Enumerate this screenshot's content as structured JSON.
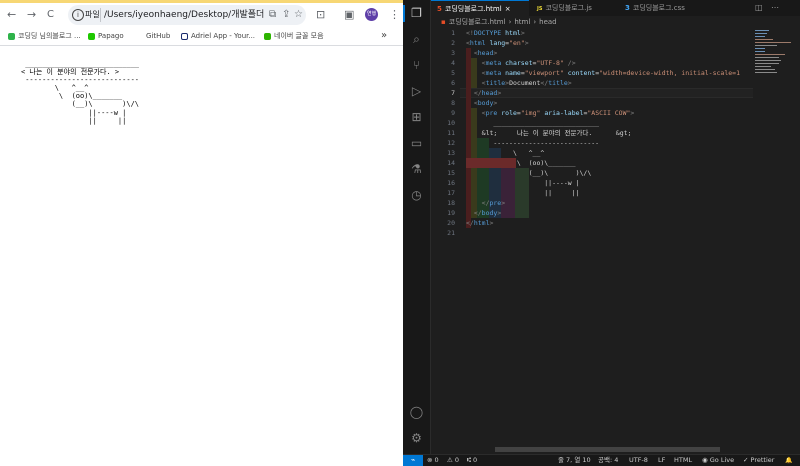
{
  "browser": {
    "nav": {
      "back": "←",
      "forward": "→",
      "reload": "C"
    },
    "omnibox": {
      "info_icon": "i",
      "chip": "파일",
      "url": "/Users/iyeonhaeng/Desktop/개발폴더/html테...",
      "translate_icon": "⧉",
      "share_icon": "⇪",
      "star_icon": "☆"
    },
    "toolbar": {
      "extensions_icon": "⊡",
      "sidepanel_icon": "▣",
      "avatar": "연행",
      "menu_icon": "⋮"
    },
    "bookmarks": [
      {
        "label": "코딩딩 님의블로그 ...",
        "color": "#2eb34a"
      },
      {
        "label": "Papago",
        "color": "#1ec800"
      },
      {
        "label": "GitHub",
        "color": "#ffffff"
      },
      {
        "label": "Adriel App - Your...",
        "color": "#ffffff"
      },
      {
        "label": "네이버 글꼴 모음",
        "color": "#2db400"
      }
    ],
    "bookmarks_more": "»",
    "ascii_art": " ___________________________\n< 나는 이 분야의 전문가다. >\n ---------------------------\n        \\   ^__^\n         \\  (oo)\\_______\n            (__)\\       )\\/\\\n                ||----w |\n                ||     ||"
  },
  "vscode": {
    "tabs": [
      {
        "label": "코딩딩블로그.html",
        "icon": "5",
        "icon_color": "#e44d26",
        "active": true,
        "close": "×"
      },
      {
        "label": "코딩딩블로그.js",
        "icon": "JS",
        "icon_color": "#f1dd35",
        "active": false
      },
      {
        "label": "코딩딩블로그.css",
        "icon": "3",
        "icon_color": "#42a5f5",
        "active": false
      }
    ],
    "editor_actions": {
      "split": "◫",
      "more": "⋯"
    },
    "breadcrumb": {
      "file": "코딩딩블로그.html",
      "sep1": "›",
      "el1": "html",
      "sep2": "›",
      "el2": "head"
    },
    "activity_icons": [
      {
        "name": "explorer-icon",
        "glyph": "❐"
      },
      {
        "name": "search-icon",
        "glyph": "⌕"
      },
      {
        "name": "source-control-icon",
        "glyph": "⑂"
      },
      {
        "name": "run-debug-icon",
        "glyph": "▷"
      },
      {
        "name": "extensions-icon",
        "glyph": "⊞"
      },
      {
        "name": "remote-explorer-icon",
        "glyph": "▭"
      },
      {
        "name": "testing-icon",
        "glyph": "⚗"
      },
      {
        "name": "timeline-icon",
        "glyph": "◷"
      }
    ],
    "activity_bottom": {
      "accounts": "◯",
      "manage": "⚙"
    },
    "line_numbers": [
      "1",
      "2",
      "3",
      "4",
      "5",
      "6",
      "7",
      "8",
      "9",
      "10",
      "11",
      "12",
      "13",
      "14",
      "15",
      "16",
      "17",
      "18",
      "19",
      "20",
      "21"
    ],
    "code": [
      [
        [
          "p",
          "<!"
        ],
        [
          "t",
          "DOCTYPE"
        ],
        [
          "a",
          " html"
        ],
        [
          "p",
          ">"
        ]
      ],
      [
        [
          "p",
          "<"
        ],
        [
          "t",
          "html"
        ],
        [
          "a",
          " lang"
        ],
        [
          "x",
          "="
        ],
        [
          "s",
          "\"en\""
        ],
        [
          "p",
          ">"
        ]
      ],
      [
        [
          "x",
          "  "
        ],
        [
          "p",
          "<"
        ],
        [
          "t",
          "head"
        ],
        [
          "p",
          ">"
        ]
      ],
      [
        [
          "x",
          "    "
        ],
        [
          "p",
          "<"
        ],
        [
          "t",
          "meta"
        ],
        [
          "a",
          " charset"
        ],
        [
          "x",
          "="
        ],
        [
          "s",
          "\"UTF-8\""
        ],
        [
          "p",
          " />"
        ]
      ],
      [
        [
          "x",
          "    "
        ],
        [
          "p",
          "<"
        ],
        [
          "t",
          "meta"
        ],
        [
          "a",
          " name"
        ],
        [
          "x",
          "="
        ],
        [
          "s",
          "\"viewport\""
        ],
        [
          "a",
          " content"
        ],
        [
          "x",
          "="
        ],
        [
          "s",
          "\"width=device-width, initial-scale=1"
        ]
      ],
      [
        [
          "x",
          "    "
        ],
        [
          "p",
          "<"
        ],
        [
          "t",
          "title"
        ],
        [
          "p",
          ">"
        ],
        [
          "x",
          "Document"
        ],
        [
          "p",
          "</"
        ],
        [
          "t",
          "title"
        ],
        [
          "p",
          ">"
        ]
      ],
      [
        [
          "x",
          "  "
        ],
        [
          "p",
          "</"
        ],
        [
          "t",
          "head"
        ],
        [
          "p",
          ">"
        ]
      ],
      [
        [
          "x",
          "  "
        ],
        [
          "p",
          "<"
        ],
        [
          "t",
          "body"
        ],
        [
          "p",
          ">"
        ]
      ],
      [
        [
          "x",
          "    "
        ],
        [
          "p",
          "<"
        ],
        [
          "t",
          "pre"
        ],
        [
          "a",
          " role"
        ],
        [
          "x",
          "="
        ],
        [
          "s",
          "\"img\""
        ],
        [
          "a",
          " aria-label"
        ],
        [
          "x",
          "="
        ],
        [
          "s",
          "\"ASCII COW\""
        ],
        [
          "p",
          ">"
        ]
      ],
      [
        [
          "x",
          "       ___________________________"
        ]
      ],
      [
        [
          "x",
          "    &lt;     나는 이 분야의 전문가다.      &gt;"
        ]
      ],
      [
        [
          "x",
          "       ---------------------------"
        ]
      ],
      [
        [
          "x",
          "            \\   ^__^"
        ]
      ],
      [
        [
          "x",
          "             \\  (oo)\\_______"
        ]
      ],
      [
        [
          "x",
          "                (__)\\       )\\/\\"
        ]
      ],
      [
        [
          "x",
          "                    ||----w |"
        ]
      ],
      [
        [
          "x",
          "                    ||     ||"
        ]
      ],
      [
        [
          "x",
          "    "
        ],
        [
          "p",
          "</"
        ],
        [
          "t",
          "pre"
        ],
        [
          "p",
          ">"
        ]
      ],
      [
        [
          "x",
          "  "
        ],
        [
          "p",
          "</"
        ],
        [
          "t",
          "body"
        ],
        [
          "p",
          ">"
        ]
      ],
      [
        [
          "p",
          "</"
        ],
        [
          "t",
          "html"
        ],
        [
          "p",
          ">"
        ]
      ],
      []
    ],
    "status": {
      "remote": "⌁",
      "errors": "⊗ 0",
      "warnings": "⚠ 0",
      "ports": "⑆ 0",
      "cursor": "줄 7, 열 10",
      "spaces": "공백: 4",
      "encoding": "UTF-8",
      "eol": "LF",
      "language": "HTML",
      "golive": "◉ Go Live",
      "prettier": "✓ Prettier",
      "bell": "🔔"
    }
  }
}
